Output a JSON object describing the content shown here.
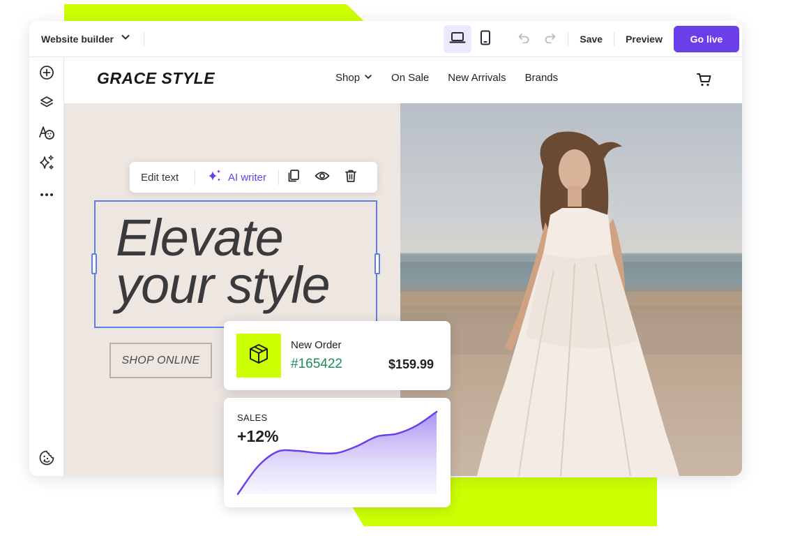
{
  "colors": {
    "accent": "#6b3ee9",
    "lime": "#ccff00",
    "selection": "#5b7fe8",
    "order_id": "#1d8a5a"
  },
  "topbar": {
    "brand_menu_label": "Website builder",
    "brand_menu_icon": "chevron-down-icon",
    "device_desktop_icon": "laptop-icon",
    "device_mobile_icon": "phone-icon",
    "undo_icon": "undo-icon",
    "redo_icon": "redo-icon",
    "save_label": "Save",
    "preview_label": "Preview",
    "go_live_label": "Go live"
  },
  "sidebar": {
    "items": [
      {
        "icon": "add-circle-icon"
      },
      {
        "icon": "layers-icon"
      },
      {
        "icon": "typography-palette-icon"
      },
      {
        "icon": "sparkles-icon"
      },
      {
        "icon": "more-dots-icon"
      },
      {
        "icon": "cookie-icon"
      }
    ]
  },
  "site": {
    "logo": "GRACE STYLE",
    "nav": [
      {
        "label": "Shop",
        "has_dropdown": true
      },
      {
        "label": "On Sale"
      },
      {
        "label": "New Arrivals"
      },
      {
        "label": "Brands"
      }
    ],
    "cart_icon": "cart-icon"
  },
  "text_toolbar": {
    "edit_label": "Edit text",
    "ai_label": "AI writer",
    "duplicate_icon": "copy-icon",
    "visibility_icon": "eye-icon",
    "delete_icon": "trash-icon"
  },
  "hero": {
    "heading_line1": "Elevate",
    "heading_line2": "your style",
    "cta_label": "SHOP ONLINE"
  },
  "order_card": {
    "icon": "package-icon",
    "title": "New Order",
    "order_id": "#165422",
    "price": "$159.99"
  },
  "sales_card": {
    "label": "SALES",
    "value": "+12%"
  },
  "chart_data": {
    "type": "area",
    "title": "SALES",
    "x": [
      0,
      1,
      2,
      3,
      4,
      5,
      6,
      7,
      8,
      9,
      10
    ],
    "values": [
      0,
      40,
      62,
      63,
      60,
      60,
      70,
      84,
      88,
      100,
      120
    ],
    "ylim": [
      0,
      120
    ],
    "grid": false,
    "legend": "none"
  }
}
